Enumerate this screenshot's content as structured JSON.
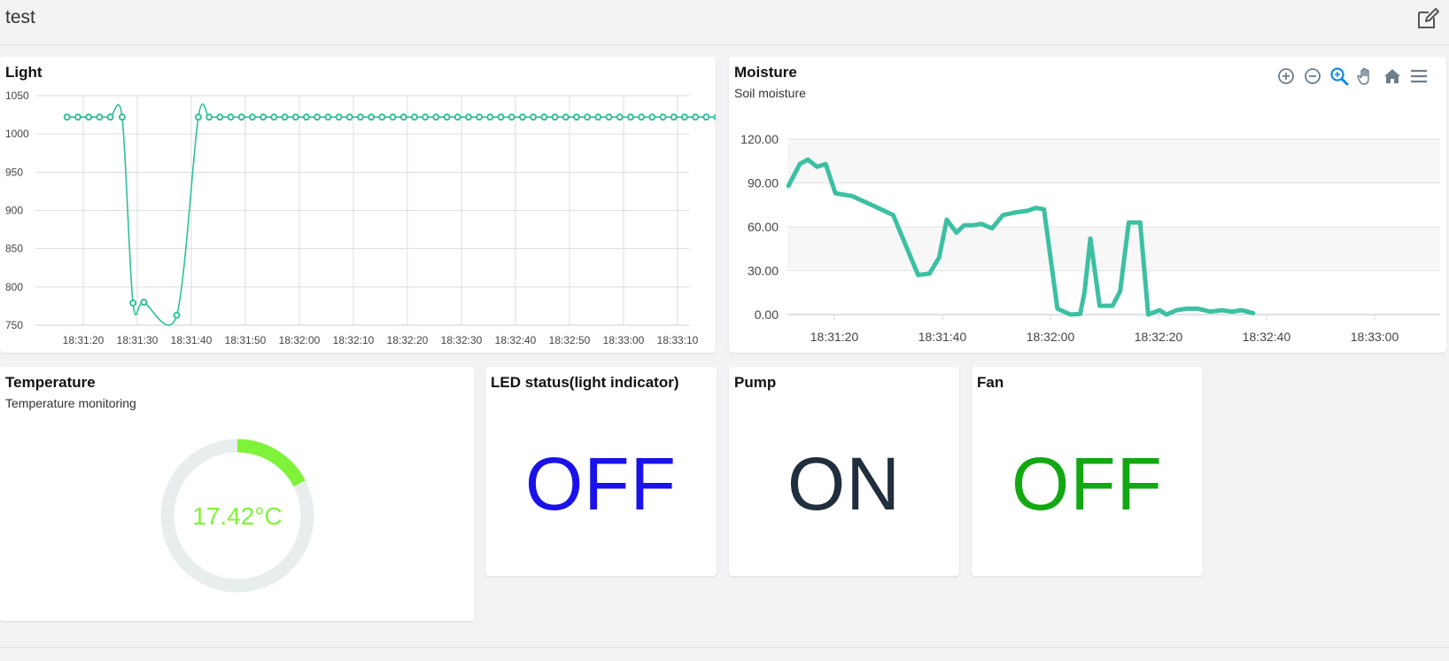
{
  "app": {
    "title": "test"
  },
  "icons": {
    "edit": "edit-icon"
  },
  "light": {
    "title": "Light",
    "chart_data": {
      "type": "line",
      "title": "Light",
      "xlabel": "",
      "ylabel": "",
      "ylim": [
        750,
        1050
      ],
      "yticks": [
        "1050",
        "1000",
        "950",
        "900",
        "850",
        "800",
        "750"
      ],
      "xticks": [
        "18:31:20",
        "18:31:30",
        "18:31:40",
        "18:31:50",
        "18:32:00",
        "18:32:10",
        "18:32:20",
        "18:32:30",
        "18:32:40",
        "18:32:50",
        "18:33:00",
        "18:33:10"
      ],
      "color": "#2fbf9a",
      "series": [
        {
          "x_seconds_from_18_31_17": [
            0,
            2,
            4,
            6,
            8,
            10.2,
            12.2,
            14.2,
            20.3,
            24.3,
            26.3,
            28.3,
            30.3,
            32.3,
            34.3,
            36.3,
            38.3,
            40.3,
            42.3,
            44.3,
            46.3,
            48.3,
            50.3,
            52.3,
            54.3,
            56.3,
            58.3,
            60.3,
            62.3,
            64.3,
            66.3,
            68.3,
            70.3,
            72.3,
            74.3,
            76.3,
            78.3,
            80.3,
            82.3,
            84.3,
            86.3,
            88.3,
            90.3,
            92.3,
            94.3,
            96.3,
            98.3,
            100.3,
            102.3,
            104.3,
            106.3,
            108.3,
            110.3,
            112.3,
            114.3,
            116.3,
            118.3,
            120.3,
            122.3,
            124.3
          ],
          "values": [
            1022,
            1022,
            1022,
            1022,
            1022,
            1022,
            779,
            780,
            763,
            1022,
            1022,
            1022,
            1022,
            1022,
            1022,
            1022,
            1022,
            1022,
            1022,
            1022,
            1022,
            1022,
            1022,
            1022,
            1022,
            1022,
            1022,
            1022,
            1022,
            1022,
            1022,
            1022,
            1022,
            1022,
            1022,
            1022,
            1022,
            1022,
            1022,
            1022,
            1022,
            1022,
            1022,
            1022,
            1022,
            1022,
            1022,
            1022,
            1022,
            1022,
            1022,
            1022,
            1022,
            1022,
            1022,
            1022,
            1022,
            1022,
            1022,
            1022
          ]
        }
      ]
    }
  },
  "moisture": {
    "title": "Moisture",
    "subtitle": "Soil moisture",
    "toolbar": [
      "zoom-in-icon",
      "zoom-out-icon",
      "magnifier-icon",
      "pan-hand-icon",
      "home-icon",
      "menu-icon"
    ],
    "chart_data": {
      "type": "line",
      "title": "Moisture",
      "subtitle": "Soil moisture",
      "ylim": [
        0,
        130
      ],
      "yticks": [
        "120.00",
        "90.00",
        "60.00",
        "30.00",
        "0.00"
      ],
      "xticks": [
        "18:31:20",
        "18:31:40",
        "18:32:00",
        "18:32:20",
        "18:32:40",
        "18:33:00"
      ],
      "color": "#3cc0a1",
      "series": [
        {
          "x": [
            -8.5,
            -6.4,
            -4.9,
            -3.2,
            -1.6,
            0.2,
            3.3,
            6.3,
            8.6,
            10.9,
            15.5,
            17.6,
            19.4,
            20.8,
            22.6,
            24,
            25.5,
            27.2,
            29.2,
            31.2,
            33.7,
            35.8,
            37.3,
            38.8,
            41.3,
            43.7,
            45.5,
            46.3,
            47.4,
            49.1,
            51.5,
            52.9,
            54.5,
            56.6,
            58.1,
            60.2,
            61.5,
            63.3,
            65.2,
            67.3,
            69.6,
            71.7,
            73.6,
            75.4,
            77.5
          ],
          "values": [
            88,
            103,
            106,
            101,
            103,
            83,
            81,
            76,
            72,
            68,
            27,
            28,
            39,
            65,
            56,
            61,
            61,
            62,
            59,
            68,
            70,
            71,
            73,
            72,
            4,
            0,
            0.5,
            15,
            52,
            6,
            6,
            16,
            63,
            63,
            0,
            3,
            0,
            3,
            4,
            4,
            2,
            3,
            2,
            3,
            1
          ]
        }
      ]
    }
  },
  "temperature": {
    "title": "Temperature",
    "subtitle": "Temperature monitoring",
    "value": "17.42°C",
    "fraction": 0.174,
    "color": "#7ff23a",
    "track_color": "#e8eded"
  },
  "led": {
    "title": "LED status(light indicator)",
    "value": "OFF",
    "color": "#1a12e8"
  },
  "pump": {
    "title": "Pump",
    "value": "ON",
    "color": "#202e3d"
  },
  "fan": {
    "title": "Fan",
    "value": "OFF",
    "color": "#12a812"
  }
}
